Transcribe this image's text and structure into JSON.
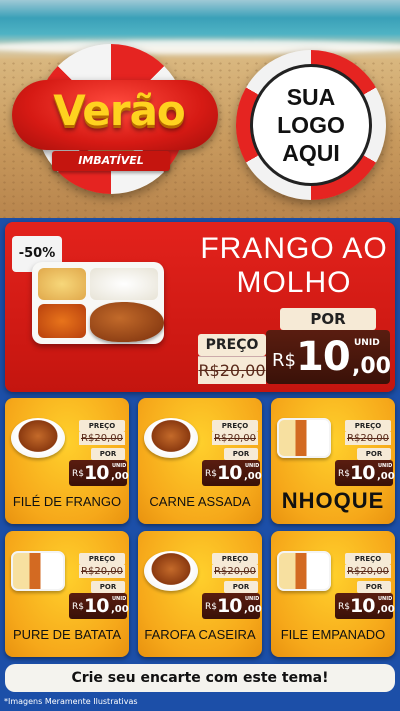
{
  "brand": {
    "title": "Verão",
    "subtitle": "IMBATÍVEL",
    "logo_placeholder": "SUA\nLOGO\nAQUI"
  },
  "featured": {
    "badge": "-50%",
    "title": "FRANGO AO MOLHO",
    "preco_label": "PREÇO",
    "old_price": "R$20,00",
    "por_label": "POR",
    "currency": "R$",
    "price_int": "10",
    "price_dec": ",00",
    "unit": "UNID"
  },
  "products": [
    {
      "name": "FILÉ DE FRANGO",
      "preco_label": "PREÇO",
      "old_price": "R$20,00",
      "por_label": "POR",
      "currency": "R$",
      "price_int": "10",
      "price_dec": ",00",
      "unit": "UNID"
    },
    {
      "name": "CARNE ASSADA",
      "preco_label": "PREÇO",
      "old_price": "R$20,00",
      "por_label": "POR",
      "currency": "R$",
      "price_int": "10",
      "price_dec": ",00",
      "unit": "UNID"
    },
    {
      "name": "NHOQUE",
      "preco_label": "PREÇO",
      "old_price": "R$20,00",
      "por_label": "POR",
      "currency": "R$",
      "price_int": "10",
      "price_dec": ",00",
      "unit": "UNID"
    },
    {
      "name": "PURE DE BATATA",
      "preco_label": "PREÇO",
      "old_price": "R$20,00",
      "por_label": "POR",
      "currency": "R$",
      "price_int": "10",
      "price_dec": ",00",
      "unit": "UNID"
    },
    {
      "name": "FAROFA CASEIRA",
      "preco_label": "PREÇO",
      "old_price": "R$20,00",
      "por_label": "POR",
      "currency": "R$",
      "price_int": "10",
      "price_dec": ",00",
      "unit": "UNID"
    },
    {
      "name": "FILE EMPANADO",
      "preco_label": "PREÇO",
      "old_price": "R$20,00",
      "por_label": "POR",
      "currency": "R$",
      "price_int": "10",
      "price_dec": ",00",
      "unit": "UNID"
    }
  ],
  "cta": "Crie seu encarte com este tema!",
  "disclaimer": "*Imagens Meramente Ilustrativas",
  "colors": {
    "background": "#1c4fa8",
    "featured_red": "#e3221c",
    "card_yellow": "#ffd02c",
    "price_brown": "#5a1d10",
    "tag_cream": "#f6ead6"
  }
}
